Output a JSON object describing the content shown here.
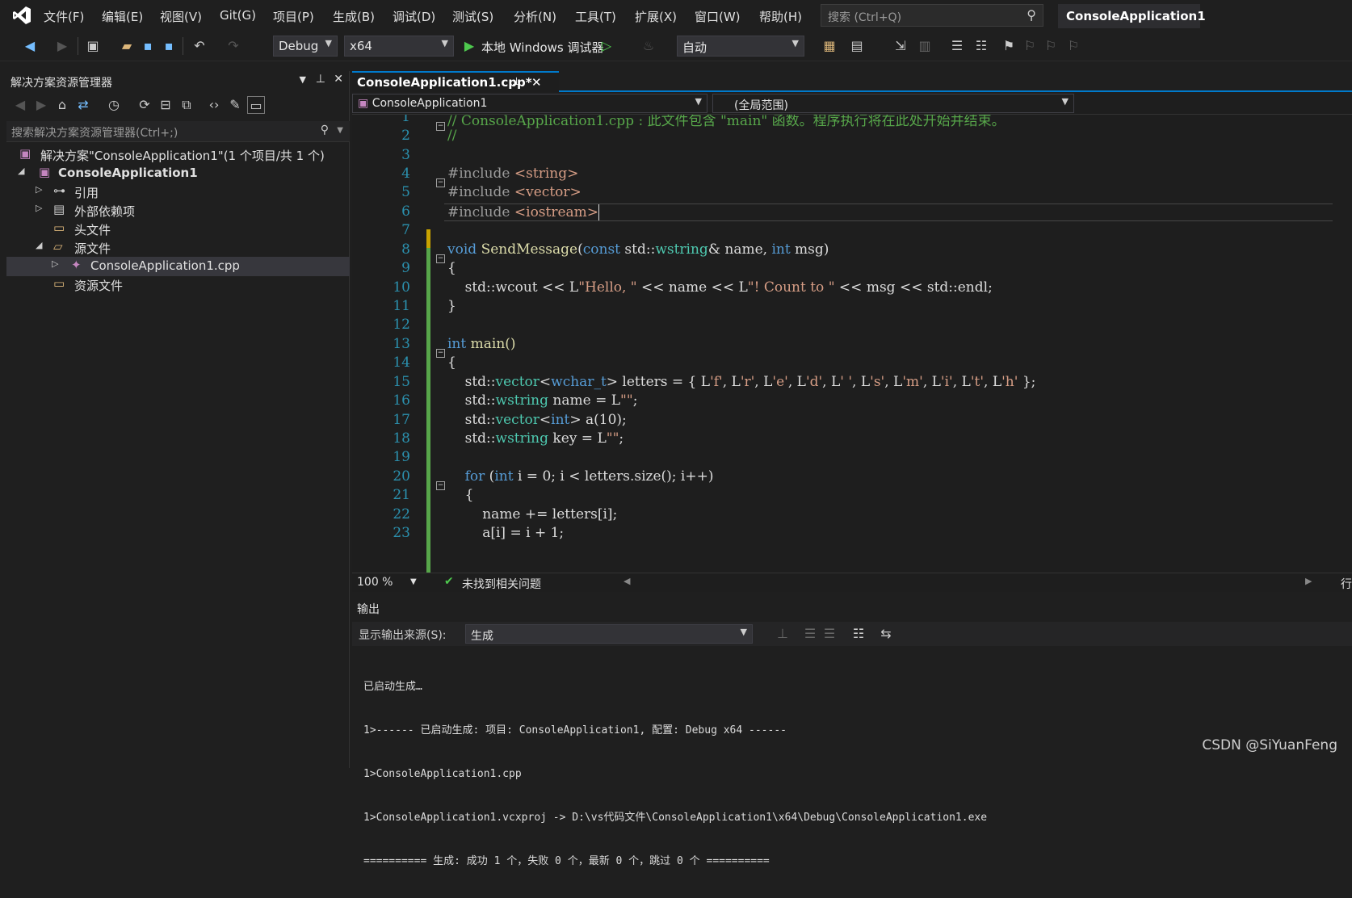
{
  "menu": [
    "文件(F)",
    "编辑(E)",
    "视图(V)",
    "Git(G)",
    "项目(P)",
    "生成(B)",
    "调试(D)",
    "测试(S)",
    "分析(N)",
    "工具(T)",
    "扩展(X)",
    "窗口(W)",
    "帮助(H)"
  ],
  "search": {
    "placeholder": "搜索 (Ctrl+Q)"
  },
  "app_title": "ConsoleApplication1",
  "toolbar": {
    "config": "Debug",
    "platform": "x64",
    "run_label": "本地 Windows 调试器",
    "auto": "自动"
  },
  "solution_explorer": {
    "title": "解决方案资源管理器",
    "search_placeholder": "搜索解决方案资源管理器(Ctrl+;)",
    "solution": "解决方案\"ConsoleApplication1\"(1 个项目/共 1 个)",
    "project": "ConsoleApplication1",
    "items": [
      "引用",
      "外部依赖项",
      "头文件",
      "源文件",
      "ConsoleApplication1.cpp",
      "资源文件"
    ]
  },
  "editor": {
    "tab_label": "ConsoleApplication1.cpp*",
    "nav_project": "ConsoleApplication1",
    "nav_scope": "(全局范围)",
    "zoom": "100 %",
    "issues": "未找到相关问题",
    "line_col_label": "行:",
    "line_numbers": [
      "1",
      "2",
      "3",
      "4",
      "5",
      "6",
      "7",
      "8",
      "9",
      "10",
      "11",
      "12",
      "13",
      "14",
      "15",
      "16",
      "17",
      "18",
      "19",
      "20",
      "21",
      "22",
      "23"
    ]
  },
  "code": {
    "l1": "// ConsoleApplication1.cpp : 此文件包含 \"main\" 函数。程序执行将在此处开始并结束。",
    "l2": "//",
    "l4a": "#include ",
    "l4b": "<string>",
    "l5a": "#include ",
    "l5b": "<vector>",
    "l6a": "#include ",
    "l6b": "<iostream>",
    "l8_void": "void",
    "l8_fn": "SendMessage",
    "l8_p1": "(",
    "l8_const": "const",
    "l8_p2": " std::",
    "l8_ws": "wstring",
    "l8_p3": "& name, ",
    "l8_int": "int",
    "l8_p4": " msg)",
    "l9": "{",
    "l10a": "    std::wcout << L",
    "l10b": "\"Hello, \"",
    "l10c": " << name << L",
    "l10d": "\"! Count to \"",
    "l10e": " << msg << std::endl;",
    "l11": "}",
    "l13_int": "int",
    "l13_rest": " main()",
    "l14": "{",
    "l15a": "    std::",
    "l15b": "vector",
    "l15c": "<",
    "l15d": "wchar_t",
    "l15e": "> letters = { L",
    "l15f": "'f'",
    "l15g": ", L",
    "l15h": "'r'",
    "l15i": ", L",
    "l15j": "'e'",
    "l15k": ", L",
    "l15l": "'d'",
    "l15m": ", L",
    "l15n": "' '",
    "l15o": ", L",
    "l15p": "'s'",
    "l15q": ", L",
    "l15r": "'m'",
    "l15s": ", L",
    "l15t": "'i'",
    "l15u": ", L",
    "l15v": "'t'",
    "l15w": ", L",
    "l15x": "'h'",
    "l15y": " };",
    "l16a": "    std::",
    "l16b": "wstring",
    "l16c": " name = L",
    "l16d": "\"\"",
    "l16e": ";",
    "l17a": "    std::",
    "l17b": "vector",
    "l17c": "<",
    "l17d": "int",
    "l17e": "> a(10);",
    "l18a": "    std::",
    "l18b": "wstring",
    "l18c": " key = L",
    "l18d": "\"\"",
    "l18e": ";",
    "l20a": "    ",
    "l20b": "for",
    "l20c": " (",
    "l20d": "int",
    "l20e": " i = 0; i < letters.size(); i++)",
    "l21": "    {",
    "l22": "        name += letters[i];",
    "l23": "        a[i] = i + 1;"
  },
  "output": {
    "title": "输出",
    "source_label": "显示输出来源(S):",
    "source_value": "生成",
    "lines": [
      "已启动生成…",
      "1>------ 已启动生成: 项目: ConsoleApplication1, 配置: Debug x64 ------",
      "1>ConsoleApplication1.cpp",
      "1>ConsoleApplication1.vcxproj -> D:\\vs代码文件\\ConsoleApplication1\\x64\\Debug\\ConsoleApplication1.exe",
      "========== 生成: 成功 1 个，失败 0 个，最新 0 个，跳过 0 个 =========="
    ]
  },
  "watermark": "CSDN @SiYuanFeng"
}
